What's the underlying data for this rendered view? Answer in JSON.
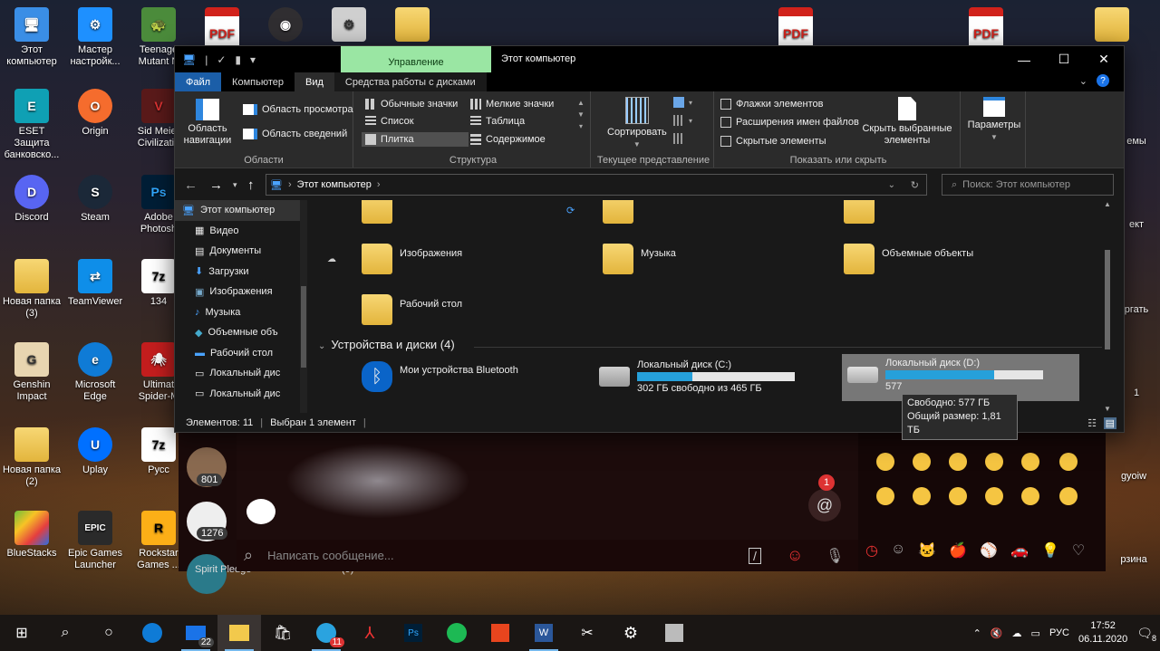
{
  "desktop": {
    "icons": [
      {
        "label": "Этот компьютер",
        "glyph": "🖥"
      },
      {
        "label": "Мастер настройк...",
        "glyph": "⚙"
      },
      {
        "label": "Teenage Mutant N",
        "glyph": "🐢"
      },
      {
        "label": "ESET Защита банковско...",
        "glyph": "E"
      },
      {
        "label": "Origin",
        "glyph": "O"
      },
      {
        "label": "Sid Meier Civilizatio",
        "glyph": "V"
      },
      {
        "label": "Discord",
        "glyph": "D"
      },
      {
        "label": "Steam",
        "glyph": "S"
      },
      {
        "label": "Adobe Photosh",
        "glyph": "Ps"
      },
      {
        "label": "Новая папка (3)",
        "glyph": ""
      },
      {
        "label": "TeamViewer",
        "glyph": "⇄"
      },
      {
        "label": "134",
        "glyph": "7z"
      },
      {
        "label": "Genshin Impact",
        "glyph": "G"
      },
      {
        "label": "Microsoft Edge",
        "glyph": "e"
      },
      {
        "label": "Ultimat Spider-M",
        "glyph": "🕷"
      },
      {
        "label": "Новая папка (2)",
        "glyph": ""
      },
      {
        "label": "Uplay",
        "glyph": "U"
      },
      {
        "label": "Русс",
        "glyph": "7z"
      },
      {
        "label": "BlueStacks",
        "glyph": "B"
      },
      {
        "label": "Epic Games Launcher",
        "glyph": "EPIC"
      },
      {
        "label": "Rockstar Games ...",
        "glyph": "R"
      }
    ],
    "right_labels": [
      "емы",
      "ект",
      "ргать",
      "1",
      "gyoiw",
      "рзина"
    ],
    "pdf_label": "PDF"
  },
  "explorer": {
    "quick_access_sep": "|",
    "manage_label": "Управление",
    "title": "Этот компьютер",
    "controls": {
      "minimize": "—",
      "maximize": "☐",
      "close": "✕"
    },
    "tabs": [
      "Файл",
      "Компьютер",
      "Вид",
      "Средства работы с дисками"
    ],
    "help": "?",
    "ribbon": {
      "panes": {
        "nav_pane": "Область навигации",
        "preview": "Область просмотра",
        "details": "Область сведений",
        "group": "Области"
      },
      "layout": {
        "items": [
          "Обычные значки",
          "Мелкие значки",
          "Список",
          "Таблица",
          "Плитка",
          "Содержимое"
        ],
        "group": "Структура"
      },
      "current_view": {
        "sort": "Сортировать",
        "group": "Текущее представление"
      },
      "show_hide": {
        "checkboxes": [
          "Флажки элементов",
          "Расширения имен файлов",
          "Скрытые элементы"
        ],
        "hide_selected": "Скрыть выбранные элементы",
        "group": "Показать или скрыть"
      },
      "options": "Параметры"
    },
    "address": {
      "location": "Этот компьютер",
      "search_placeholder": "Поиск: Этот компьютер"
    },
    "nav_items": [
      "Этот компьютер",
      "Видео",
      "Документы",
      "Загрузки",
      "Изображения",
      "Музыка",
      "Объемные объ",
      "Рабочий стол",
      "Локальный дис",
      "Локальный дис"
    ],
    "folders": [
      "Изображения",
      "Музыка",
      "Объемные объекты",
      "Рабочий стол"
    ],
    "section_devices": "Устройства и диски (4)",
    "bluetooth": "Мои устройства Bluetooth",
    "drives": [
      {
        "name": "Локальный диск (C:)",
        "info": "302 ГБ свободно из 465 ГБ",
        "used": 0.35
      },
      {
        "name": "Локальный диск (D:)",
        "info": "577",
        "used": 0.69
      }
    ],
    "tooltip": {
      "free": "Свободно: 577 ГБ",
      "total": "Общий размер: 1,81 ТБ"
    },
    "status": {
      "count": "Элементов: 11",
      "selected": "Выбран 1 элемент"
    }
  },
  "telegram": {
    "counters": [
      "801",
      "1276"
    ],
    "mention_count": "1",
    "compose_placeholder": "Написать сообщение...",
    "chat_label_left": "Spirit Pledge",
    "chat_label_mid": "(9)"
  },
  "taskbar": {
    "mail_badge": "22",
    "telegram_badge": "11",
    "tray": {
      "lang": "РУС",
      "time": "17:52",
      "date": "06.11.2020",
      "notif_count": "8"
    }
  }
}
